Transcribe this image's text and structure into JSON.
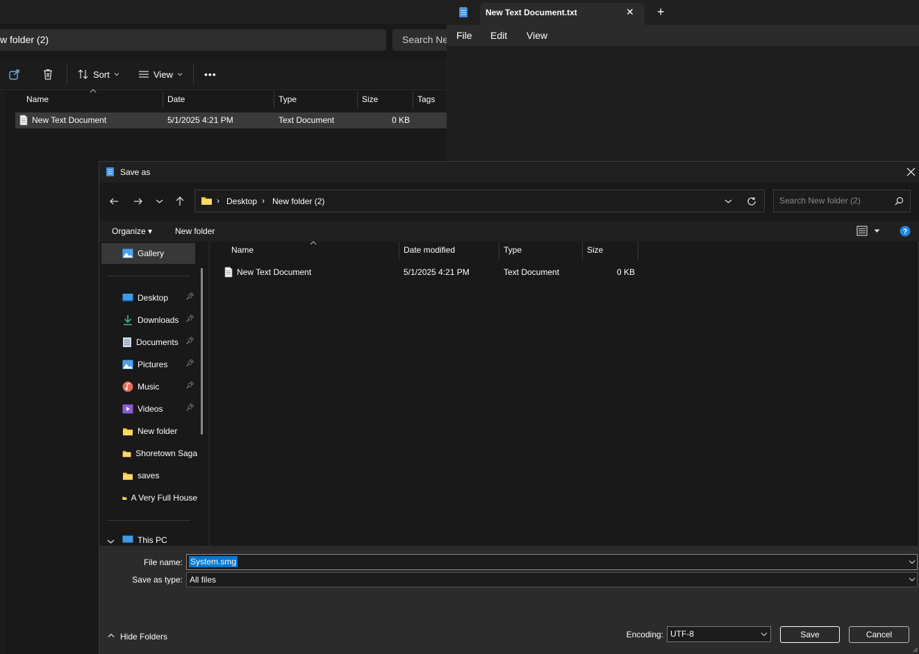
{
  "explorer": {
    "address": "w folder (2)",
    "search_placeholder": "Search Ne",
    "toolbar": {
      "sort": "Sort",
      "view": "View",
      "more": "•••"
    },
    "columns": [
      "Name",
      "Date",
      "Type",
      "Size",
      "Tags"
    ],
    "file": {
      "name": "New Text Document",
      "date": "5/1/2025 4:21 PM",
      "type": "Text Document",
      "size": "0 KB"
    }
  },
  "notepad": {
    "tab_title": "New Text Document.txt",
    "close_glyph": "✕",
    "new_tab_glyph": "+",
    "menu": {
      "file": "File",
      "edit": "Edit",
      "view": "View"
    }
  },
  "dialog": {
    "title": "Save as",
    "breadcrumb": {
      "desktop": "Desktop",
      "folder": "New folder (2)"
    },
    "search_placeholder": "Search New folder (2)",
    "commands": {
      "organize": "Organize ▾",
      "new_folder": "New folder"
    },
    "nav": {
      "gallery": "Gallery",
      "desktop": "Desktop",
      "downloads": "Downloads",
      "documents": "Documents",
      "pictures": "Pictures",
      "music": "Music",
      "videos": "Videos",
      "new_folder": "New folder",
      "shoretown": "Shoretown Saga",
      "saves": "saves",
      "very_full": "A Very Full House",
      "this_pc": "This PC"
    },
    "columns": {
      "name": "Name",
      "date": "Date modified",
      "type": "Type",
      "size": "Size"
    },
    "file": {
      "name": "New Text Document",
      "date": "5/1/2025 4:21 PM",
      "type": "Text Document",
      "size": "0 KB"
    },
    "file_name_label": "File name:",
    "file_name_value": "System.smg",
    "save_type_label": "Save as type:",
    "save_type_value": "All files",
    "encoding_label": "Encoding:",
    "encoding_value": "UTF-8",
    "hide_folders": "Hide Folders",
    "save": "Save",
    "cancel": "Cancel"
  },
  "colors": {
    "accent": "#0078d4",
    "folder": "#f4c430",
    "bg": "#191919"
  }
}
